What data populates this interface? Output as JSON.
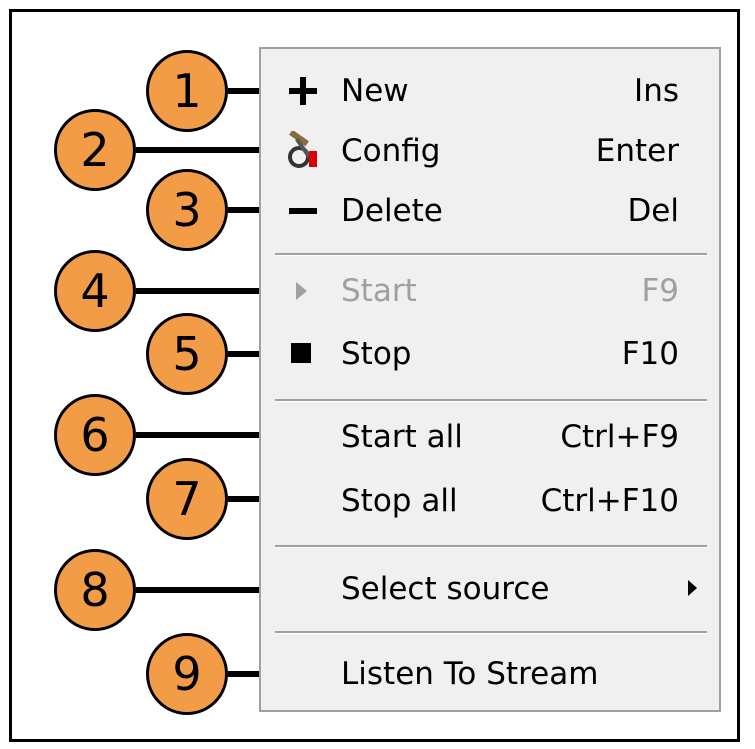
{
  "menu": {
    "items": [
      {
        "label": "New",
        "shortcut": "Ins",
        "icon": "plus-icon",
        "enabled": true
      },
      {
        "label": "Config",
        "shortcut": "Enter",
        "icon": "config-tools-icon",
        "enabled": true
      },
      {
        "label": "Delete",
        "shortcut": "Del",
        "icon": "minus-icon",
        "enabled": true
      },
      {
        "label": "Start",
        "shortcut": "F9",
        "icon": "play-icon",
        "enabled": false
      },
      {
        "label": "Stop",
        "shortcut": "F10",
        "icon": "stop-icon",
        "enabled": true
      },
      {
        "label": "Start all",
        "shortcut": "Ctrl+F9",
        "icon": "",
        "enabled": true
      },
      {
        "label": "Stop all",
        "shortcut": "Ctrl+F10",
        "icon": "",
        "enabled": true
      },
      {
        "label": "Select source",
        "shortcut": "",
        "icon": "submenu-arrow-icon",
        "enabled": true
      },
      {
        "label": "Listen To Stream",
        "shortcut": "",
        "icon": "",
        "enabled": true
      }
    ]
  },
  "callouts": [
    "1",
    "2",
    "3",
    "4",
    "5",
    "6",
    "7",
    "8",
    "9"
  ],
  "colors": {
    "callout_fill": "#f29c47",
    "menu_bg": "#f0f0f0",
    "disabled_text": "#a0a0a0"
  }
}
